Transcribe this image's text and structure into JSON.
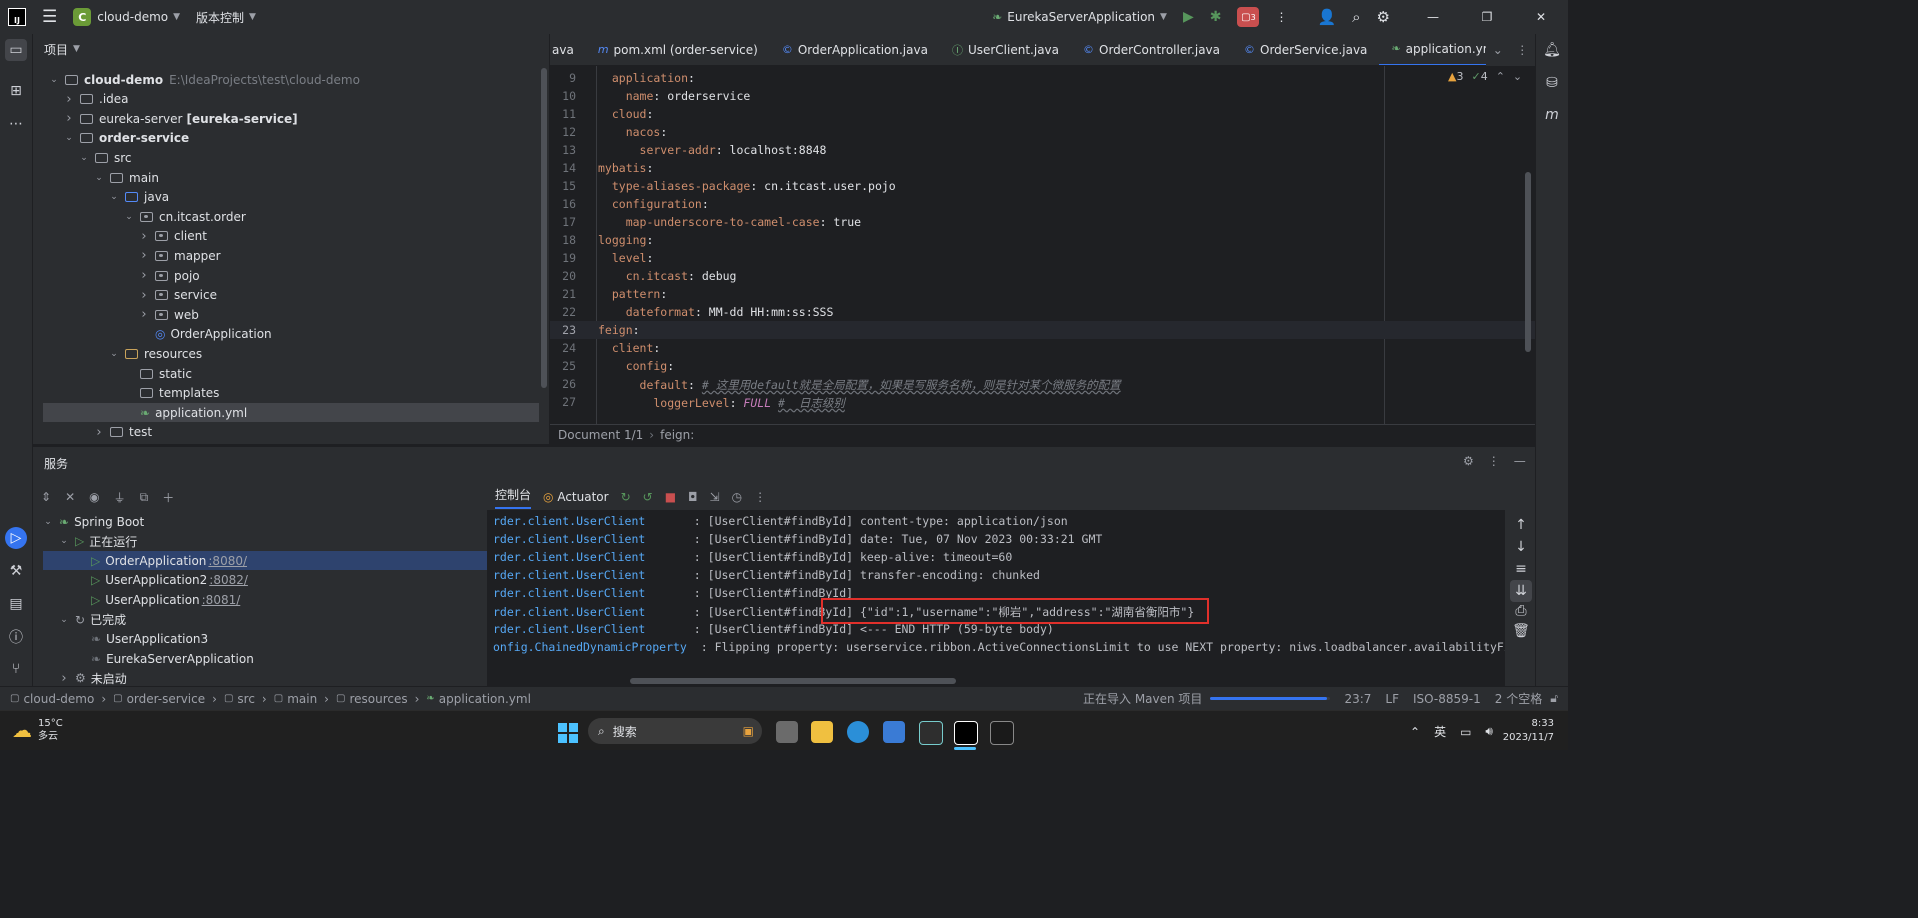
{
  "titlebar": {
    "project_badge": "C",
    "project_name": "cloud-demo",
    "vcs": "版本控制",
    "run_config": "EurekaServerApplication",
    "badge_count": "3"
  },
  "project_panel": {
    "title": "项目",
    "tree": [
      {
        "label": "cloud-demo",
        "extra": "E:\\IdeaProjects\\test\\cloud-demo",
        "bold": true
      },
      {
        "label": ".idea"
      },
      {
        "label": "eureka-server",
        "extra": "[eureka-service]"
      },
      {
        "label": "order-service",
        "bold": true
      },
      {
        "label": "src"
      },
      {
        "label": "main"
      },
      {
        "label": "java"
      },
      {
        "label": "cn.itcast.order"
      },
      {
        "label": "client"
      },
      {
        "label": "mapper"
      },
      {
        "label": "pojo"
      },
      {
        "label": "service"
      },
      {
        "label": "web"
      },
      {
        "label": "OrderApplication"
      },
      {
        "label": "resources"
      },
      {
        "label": "static"
      },
      {
        "label": "templates"
      },
      {
        "label": "application.yml"
      },
      {
        "label": "test"
      }
    ]
  },
  "editor": {
    "tabs": [
      {
        "label": "ava"
      },
      {
        "label": "pom.xml (order-service)",
        "icon": "m"
      },
      {
        "label": "OrderApplication.java",
        "icon": "C"
      },
      {
        "label": "UserClient.java",
        "icon": "I"
      },
      {
        "label": "OrderController.java",
        "icon": "C"
      },
      {
        "label": "OrderService.java",
        "icon": "C"
      },
      {
        "label": "application.yml",
        "icon": "Y",
        "active": true
      }
    ],
    "warnings": "3",
    "checks": "4",
    "line_numbers": [
      "9",
      "10",
      "11",
      "12",
      "13",
      "14",
      "15",
      "16",
      "17",
      "18",
      "19",
      "20",
      "21",
      "22",
      "23",
      "24",
      "25",
      "26",
      "27"
    ],
    "lines": [
      {
        "k": "  application",
        "r": ":"
      },
      {
        "k": "    name",
        "r": ": orderservice"
      },
      {
        "k": "  cloud",
        "r": ":"
      },
      {
        "k": "    nacos",
        "r": ":"
      },
      {
        "k": "      server-addr",
        "r": ": localhost:8848"
      },
      {
        "k": "mybatis",
        "r": ":"
      },
      {
        "k": "  type-aliases-package",
        "r": ": cn.itcast.user.pojo"
      },
      {
        "k": "  configuration",
        "r": ":"
      },
      {
        "k": "    map-underscore-to-camel-case",
        "r": ": true"
      },
      {
        "k": "logging",
        "r": ":"
      },
      {
        "k": "  level",
        "r": ":"
      },
      {
        "k": "    cn.itcast",
        "r": ": debug"
      },
      {
        "k": "  pattern",
        "r": ":"
      },
      {
        "k": "    dateformat",
        "r": ": MM-dd HH:mm:ss:SSS"
      },
      {
        "k": "feign",
        "r": ":"
      },
      {
        "k": "  client",
        "r": ":"
      },
      {
        "k": "    config",
        "r": ":"
      },
      {
        "k": "      default",
        "r": ": ",
        "c": "# 这里用default就是全局配置，如果是写服务名称，则是针对某个微服务的配置"
      },
      {
        "k": "        loggerLevel",
        "r": ": ",
        "v": "FULL",
        "c": "#  日志级别"
      }
    ],
    "breadcrumb_doc": "Document 1/1",
    "breadcrumb_key": "feign:"
  },
  "services": {
    "title": "服务",
    "tab_console": "控制台",
    "tab_actuator": "Actuator",
    "tree": [
      {
        "label": "Spring Boot"
      },
      {
        "label": "正在运行"
      },
      {
        "label": "OrderApplication",
        "port": ":8080/"
      },
      {
        "label": "UserApplication2",
        "port": ":8082/"
      },
      {
        "label": "UserApplication",
        "port": ":8081/"
      },
      {
        "label": "已完成"
      },
      {
        "label": "UserApplication3"
      },
      {
        "label": "EurekaServerApplication"
      },
      {
        "label": "未启动"
      }
    ],
    "log": [
      {
        "cls": "rder.client.UserClient",
        "msg": "       : [UserClient#findById] content-type: application/json"
      },
      {
        "cls": "rder.client.UserClient",
        "msg": "       : [UserClient#findById] date: Tue, 07 Nov 2023 00:33:21 GMT"
      },
      {
        "cls": "rder.client.UserClient",
        "msg": "       : [UserClient#findById] keep-alive: timeout=60"
      },
      {
        "cls": "rder.client.UserClient",
        "msg": "       : [UserClient#findById] transfer-encoding: chunked"
      },
      {
        "cls": "rder.client.UserClient",
        "msg": "       : [UserClient#findById]"
      },
      {
        "cls": "rder.client.UserClient",
        "msg": "       : [UserClient#findById] {\"id\":1,\"username\":\"柳岩\",\"address\":\"湖南省衡阳市\"}"
      },
      {
        "cls": "rder.client.UserClient",
        "msg": "       : [UserClient#findById] <--- END HTTP (59-byte body)"
      },
      {
        "cls": "onfig.ChainedDynamicProperty",
        "msg": "  : Flipping property: userservice.ribbon.ActiveConnectionsLimit to use NEXT property: niws.loadbalancer.availabilityFilteringRu"
      }
    ]
  },
  "statusbar": {
    "crumbs": [
      "cloud-demo",
      "order-service",
      "src",
      "main",
      "resources",
      "application.yml"
    ],
    "importing": "正在导入 Maven 项目",
    "position": "23:7",
    "line_sep": "LF",
    "encoding": "ISO-8859-1",
    "indent": "2 个空格"
  },
  "taskbar": {
    "temp": "15°C",
    "weather": "多云",
    "search": "搜索",
    "ime": "英",
    "time": "8:33",
    "date": "2023/11/7"
  },
  "colors": {
    "accent": "#3574f0",
    "highlight_box": "#e0302b"
  }
}
